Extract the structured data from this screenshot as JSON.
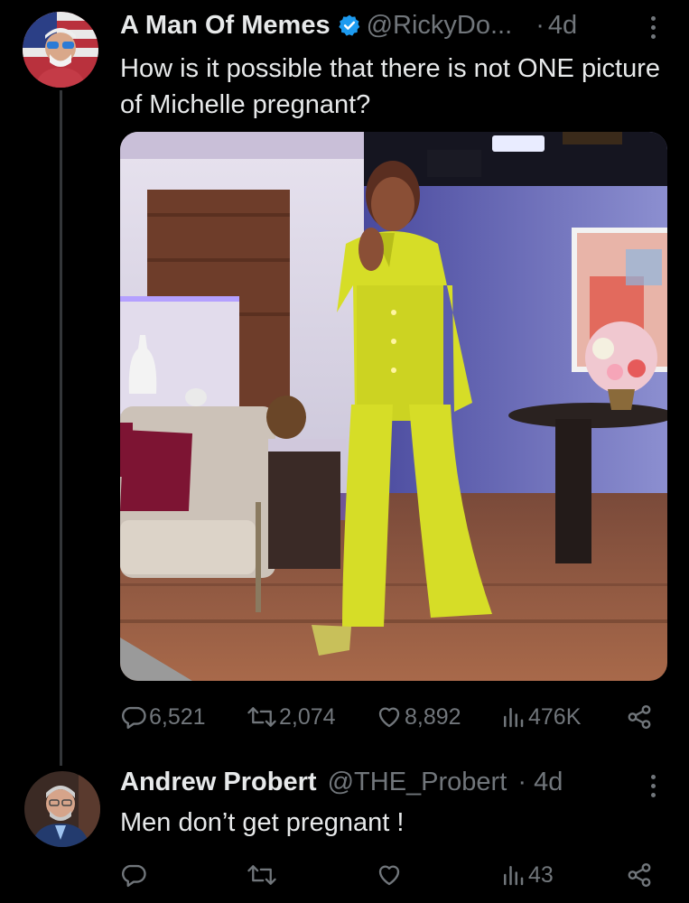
{
  "tweet": {
    "author_name": "A Man Of Memes",
    "handle": "@RickyDo...",
    "separator": "·",
    "age": "4d",
    "text": "How is it possible that there is not ONE picture of Michelle pregnant?",
    "stats": {
      "replies": "6,521",
      "retweets": "2,074",
      "likes": "8,892",
      "views": "476K"
    }
  },
  "reply": {
    "author_name": "Andrew Probert",
    "handle": "@THE_Probert",
    "separator": "·",
    "age": "4d",
    "text": "Men don’t get pregnant !",
    "stats": {
      "views": "43"
    }
  },
  "colors": {
    "background": "#000000",
    "text": "#e7e9ea",
    "muted": "#71767b",
    "verified": "#1d9bf0",
    "suit": "#d6dd27"
  },
  "icons": [
    "reply-icon",
    "retweet-icon",
    "like-icon",
    "views-icon",
    "share-icon",
    "verified-icon",
    "more-icon"
  ]
}
